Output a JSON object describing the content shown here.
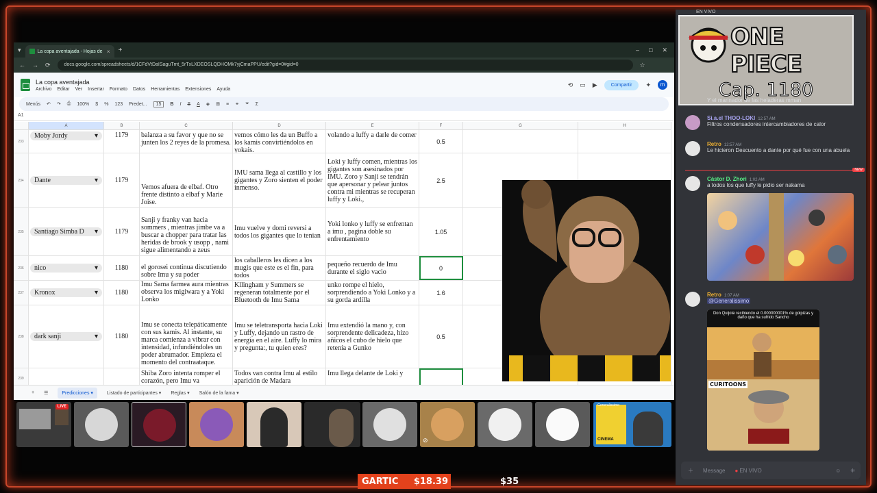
{
  "browser": {
    "tab_title": "La copa aventajada - Hojas de",
    "url": "docs.google.com/spreadsheets/d/1CFdVtDaISaguTmt_5rTxLXDEOSLQDHOMk7yjCmaPPU/edit?gid=0#gid=0"
  },
  "sheet": {
    "title": "La copa aventajada",
    "menus": [
      "Archivo",
      "Editar",
      "Ver",
      "Insertar",
      "Formato",
      "Datos",
      "Herramientas",
      "Extensiones",
      "Ayuda"
    ],
    "share_label": "Compartir",
    "user_initial": "m",
    "toolbar": {
      "search": "Menús",
      "zoom": "100%",
      "currency": "$",
      "percent": "%",
      "format_num": "123",
      "font": "Predet...",
      "font_size": "15",
      "bold": "B",
      "italic": "I",
      "strike": "S",
      "text_color": "A"
    },
    "cell_ref": "A1",
    "columns": [
      "A",
      "B",
      "C",
      "D",
      "E",
      "F",
      "G",
      "H"
    ],
    "rows": [
      {
        "n": "233",
        "name": "Moby Jordy",
        "cap": "1179",
        "c": "balanza a su favor y que no se junten los 2 reyes de la promesa.",
        "d": "vemos cómo les da un Buffo a los kamis convirtiéndolos en yokais.",
        "e": "volando a luffy a darle de comer",
        "f": "0.5"
      },
      {
        "n": "234",
        "name": "Dante",
        "cap": "1179",
        "c": "Vemos afuera de elbaf. Otro frente distinto a elbaf y Marie Joise.",
        "d": "IMU sama llega al castillo y los gigantes y Zoro sienten el poder inmenso.",
        "e": "Loki y luffy comen, mientras los gigantes son asesinados por IMU. Zoro y Sanji se tendrán que apersonar y pelear juntos contra mi mientras se recuperan luffy y Loki.,",
        "f": "2.5"
      },
      {
        "n": "235",
        "name": "Santiago Simba D",
        "cap": "1179",
        "c": "Sanji y franky van hacia sommers , mientras jimbe va a buscar a chopper para tratar las heridas de brook y usopp , nami sigue alimentando a zeus",
        "d": "Imu vuelve y domi reversi a todos los gigantes que lo tenian",
        "e": "Yoki lonko y luffy se enfrentan a imu , pagina doble su enfrentamiento",
        "f": "1.05"
      },
      {
        "n": "236",
        "name": "nico",
        "cap": "1180",
        "c": "el gorosei continua discutiendo sobre Imu y su poder",
        "d": "los caballeros les dicen a los mugis que este es el fin, para todos",
        "e": "pequeño recuerdo de Imu durante el siglo vacio",
        "f": "0"
      },
      {
        "n": "237",
        "name": "Kronox",
        "cap": "1180",
        "c": "Imu Sama farmea aura mientras observa los migiwara y a Yoki Lonko",
        "d": "Kllingham y Summers se regeneran totalmente por el Bluetooth de Imu Sama",
        "e": "unko rompe el hielo, sorprendiendo a Yoki Lonko y a su gorda ardilla",
        "f": "1.6"
      },
      {
        "n": "238",
        "name": "dark sanji",
        "cap": "1180",
        "c": "Imu se conecta telepáticamente con sus kamis. Al instante, su marca comienza a vibrar con intensidad, infundiéndoles un poder abrumador. Empieza el momento del contraataque.",
        "d": "Imu se teletransporta hacia Loki y Luffy, dejando un rastro de energía en el aire. Luffy lo mira y pregunta:, tu quien eres?",
        "e": "Imu extendió la mano y, con sorprendente delicadeza, hizo añicos el cubo de hielo que retenía a Gunko",
        "f": "0.5"
      },
      {
        "n": "239",
        "name": "",
        "cap": "",
        "c": "Shiba Zoro intenta romper el corazón, pero Imu va",
        "d": "Todos van contra Imu al estilo aparición de Madara",
        "e": "Imu llega delante de Loki y",
        "f": ""
      }
    ],
    "sheet_tabs": [
      "Predicciones",
      "Listado de participantes",
      "Reglas",
      "Salón de la fama"
    ]
  },
  "chat": {
    "live_label": "EN VIVO",
    "card_title": "ONE PIECE",
    "card_chapter": "Cap. 1180",
    "messages": [
      {
        "user": "",
        "time": "",
        "text": "Y el marinador de las heladeras mman",
        "color": "#dbdee1"
      },
      {
        "user": "Si.a.el THOO-LOKI",
        "time": "12:57 AM",
        "text": "Filtros condensadores intercambiadores de calor",
        "color": "#a8a4f0"
      },
      {
        "user": "Retro",
        "time": "12:57 AM",
        "text": "Le hicieron Descuento a dante por qué fue con una abuela",
        "color": "#f0b232"
      },
      {
        "user": "Cástor D. Zhori",
        "time": "1:02 AM",
        "text": "a todos los que luffy le pidio ser nakama",
        "color": "#57f287"
      },
      {
        "user": "Retro",
        "time": "1:07 AM",
        "text": "@Generalissimo",
        "color": "#f0b232"
      }
    ],
    "new_label": "NEW",
    "meme_caption": "Don Quijote recibiendo el 0.000000001% de golpizas y daño que ha sufrido Sancho",
    "meme_brand": "CURITOONS",
    "input_placeholder": "Message",
    "input_live": "EN VIVO"
  },
  "bottom": {
    "live_badge": "LIVE",
    "gartic_label": "GARTIC",
    "gartic_amount": "$18.39",
    "amount2": "$35",
    "thumb_brand": "Generalissimo",
    "thumb_cinema": "CINEMA"
  },
  "colors": {
    "frame": "#c8462a",
    "sheets_green": "#1e8e3e",
    "chat_bg": "#313338",
    "gartic": "#e3421c"
  }
}
